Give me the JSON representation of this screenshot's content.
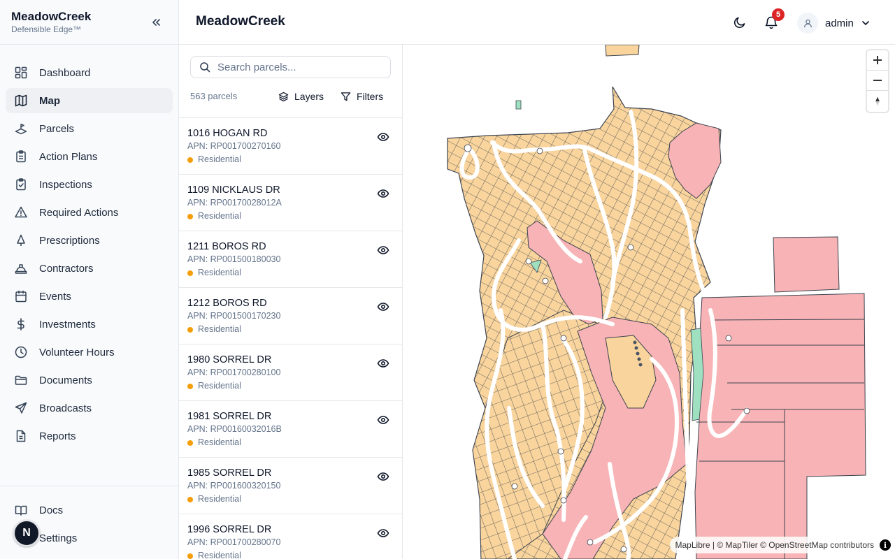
{
  "brand": {
    "title": "MeadowCreek",
    "subtitle": "Defensible Edge™"
  },
  "sidebar": {
    "items": [
      {
        "label": "Dashboard",
        "icon": "dashboard-icon"
      },
      {
        "label": "Map",
        "icon": "map-icon",
        "active": true
      },
      {
        "label": "Parcels",
        "icon": "parcels-icon"
      },
      {
        "label": "Action Plans",
        "icon": "clipboard-icon"
      },
      {
        "label": "Inspections",
        "icon": "clipboard-check-icon"
      },
      {
        "label": "Required Actions",
        "icon": "warning-icon"
      },
      {
        "label": "Prescriptions",
        "icon": "tree-icon"
      },
      {
        "label": "Contractors",
        "icon": "hard-hat-icon"
      },
      {
        "label": "Events",
        "icon": "calendar-icon"
      },
      {
        "label": "Investments",
        "icon": "dollar-icon"
      },
      {
        "label": "Volunteer Hours",
        "icon": "clock-icon"
      },
      {
        "label": "Documents",
        "icon": "folder-icon"
      },
      {
        "label": "Broadcasts",
        "icon": "send-icon"
      },
      {
        "label": "Reports",
        "icon": "report-icon"
      }
    ],
    "bottom": [
      {
        "label": "Docs",
        "icon": "book-icon"
      },
      {
        "label": "Settings",
        "icon": "settings-icon"
      }
    ],
    "avatar_letter": "N"
  },
  "header": {
    "title": "MeadowCreek",
    "notification_count": "5",
    "user": "admin"
  },
  "panel": {
    "search_placeholder": "Search parcels...",
    "count": "563 parcels",
    "layers_label": "Layers",
    "filters_label": "Filters",
    "parcels": [
      {
        "address": "1016 HOGAN RD",
        "apn": "APN: RP001700270160",
        "type": "Residential"
      },
      {
        "address": "1109 NICKLAUS DR",
        "apn": "APN: RP00170028012A",
        "type": "Residential"
      },
      {
        "address": "1211 BOROS RD",
        "apn": "APN: RP001500180030",
        "type": "Residential"
      },
      {
        "address": "1212 BOROS RD",
        "apn": "APN: RP001500170230",
        "type": "Residential"
      },
      {
        "address": "1980 SORREL DR",
        "apn": "APN: RP001700280100",
        "type": "Residential"
      },
      {
        "address": "1981 SORREL DR",
        "apn": "APN: RP00160032016B",
        "type": "Residential"
      },
      {
        "address": "1985 SORREL DR",
        "apn": "APN: RP001600320150",
        "type": "Residential"
      },
      {
        "address": "1996 SORREL DR",
        "apn": "APN: RP001700280070",
        "type": "Residential"
      }
    ]
  },
  "map": {
    "attribution": "MapLibre | © MapTiler © OpenStreetMap contributors",
    "colors": {
      "residential": "#f9d49c",
      "common": "#f7b3b5",
      "green": "#9fe0c0",
      "outline": "#3d4450",
      "road": "#ffffff"
    }
  }
}
